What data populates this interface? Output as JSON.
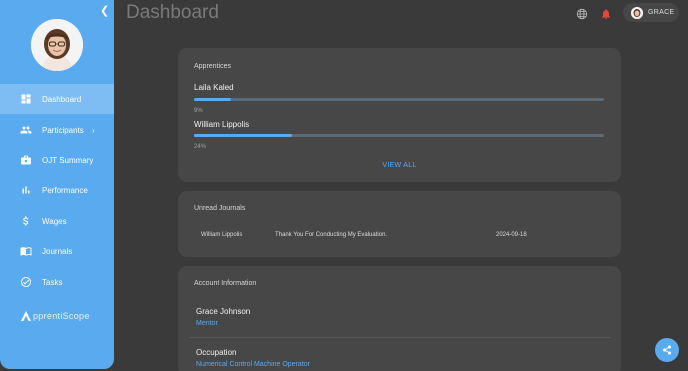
{
  "page": {
    "title": "Dashboard"
  },
  "sidebar": {
    "items": [
      {
        "label": "Dashboard",
        "icon": "dashboard-icon",
        "active": true
      },
      {
        "label": "Participants",
        "icon": "people-icon",
        "has_submenu": true
      },
      {
        "label": "OJT Summary",
        "icon": "briefcase-icon"
      },
      {
        "label": "Performance",
        "icon": "bar-chart-icon"
      },
      {
        "label": "Wages",
        "icon": "dollar-icon"
      },
      {
        "label": "Journals",
        "icon": "book-icon"
      },
      {
        "label": "Tasks",
        "icon": "check-circle-icon"
      }
    ],
    "brand": "pprentiScope"
  },
  "header": {
    "user_name": "GRACE",
    "notification_color": "#e8453c"
  },
  "apprentices": {
    "title": "Apprentices",
    "items": [
      {
        "name": "Laila Kaled",
        "percent_label": "9%",
        "progress": 0.09
      },
      {
        "name": "William Lippolis",
        "percent_label": "24%",
        "progress": 0.24
      }
    ],
    "view_all": "VIEW ALL"
  },
  "journals": {
    "title": "Unread Journals",
    "rows": [
      {
        "author": "William Lippolis",
        "subject": "Thank You For Conducting My Evaluation.",
        "date": "2024-09-18"
      }
    ]
  },
  "account": {
    "title": "Account Information",
    "name": "Grace Johnson",
    "role": "Mentor",
    "occupation_label": "Occupation",
    "occupation": "Numerical Control Machine Operator"
  },
  "colors": {
    "accent": "#5aaaf0",
    "background": "#3a3a3a",
    "card": "#474747"
  }
}
